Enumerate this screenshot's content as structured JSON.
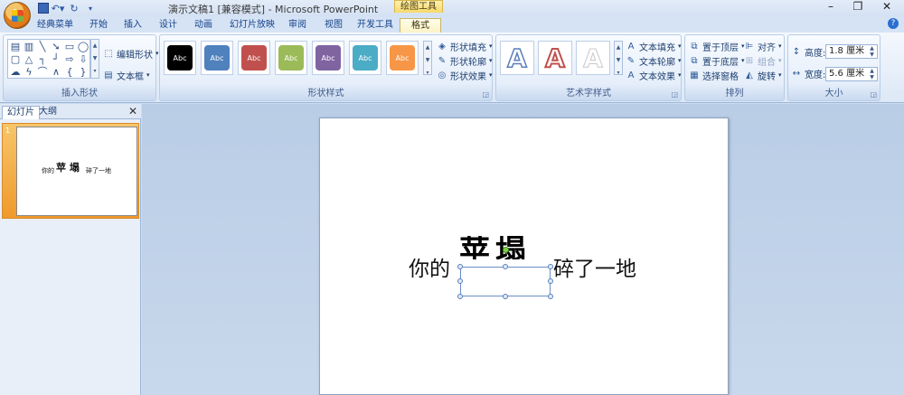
{
  "window": {
    "title": "演示文稿1 [兼容模式] - Microsoft PowerPoint",
    "context_tab_title": "绘图工具",
    "controls": [
      "–",
      "❐",
      "✕"
    ]
  },
  "tabs": [
    "经典菜单",
    "开始",
    "插入",
    "设计",
    "动画",
    "幻灯片放映",
    "审阅",
    "视图",
    "开发工具",
    "格式"
  ],
  "active_tab": "格式",
  "ribbon": {
    "insert_shapes": {
      "label": "插入形状",
      "edit_shape": "编辑形状",
      "text_box": "文本框"
    },
    "shape_styles": {
      "label": "形状样式",
      "preset_text": "Abc",
      "presets": [
        "#000000",
        "#4f81bd",
        "#c0504d",
        "#9bbb59",
        "#8064a2",
        "#4bacc6",
        "#f79646"
      ],
      "fill": "形状填充",
      "outline": "形状轮廓",
      "effects": "形状效果"
    },
    "wordart": {
      "label": "艺术字样式",
      "glyph": "A",
      "text_fill": "文本填充",
      "text_outline": "文本轮廓",
      "text_effects": "文本效果"
    },
    "arrange": {
      "label": "排列",
      "bring_front": "置于顶层",
      "send_back": "置于底层",
      "selection_pane": "选择窗格",
      "align": "对齐",
      "group": "组合",
      "rotate": "旋转"
    },
    "size": {
      "label": "大小",
      "height_label": "高度:",
      "height_value": "1.8 厘米",
      "width_label": "宽度:",
      "width_value": "5.6 厘米"
    }
  },
  "panel": {
    "tab_slides": "幻灯片",
    "tab_outline": "大纲",
    "slide_number": "1",
    "thumb_text_left": "你的",
    "thumb_text_big": "苹 塌",
    "thumb_text_right": "碎了一地"
  },
  "slide": {
    "text_left": "你的",
    "big_text": "苹塌",
    "text_right": "碎了一地"
  }
}
